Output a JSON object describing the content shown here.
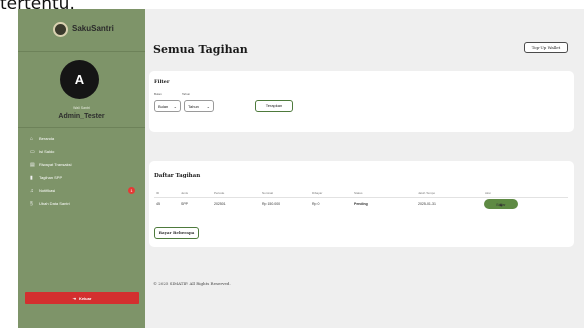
{
  "top_text": "tertentu.",
  "brand": {
    "name": "SakuSantri"
  },
  "user": {
    "avatar_letter": "A",
    "role": "Wali Santri",
    "username": "Admin_Tester"
  },
  "menu": [
    {
      "icon": "home-icon",
      "glyph": "⌂",
      "label": "Beranda"
    },
    {
      "icon": "card-icon",
      "glyph": "▭",
      "label": "Isi Saldo"
    },
    {
      "icon": "receipt-icon",
      "glyph": "▤",
      "label": "Riwayat Transaksi"
    },
    {
      "icon": "invoice-icon",
      "glyph": "▮",
      "label": "Tagihan SPP"
    },
    {
      "icon": "bell-icon",
      "glyph": "♫",
      "label": "Notifikasi",
      "badge": "1"
    },
    {
      "icon": "student-data-icon",
      "glyph": "§",
      "label": "Ubah Data Santri"
    }
  ],
  "logout_label": "Keluar",
  "main": {
    "title": "Semua Tagihan",
    "topup_label": "Top-Up Wallet"
  },
  "filter": {
    "title": "Filter",
    "month_label": "Bulan",
    "month_value": "Bulan",
    "year_label": "Tahun",
    "year_value": "Tahun",
    "apply_label": "Terapkan"
  },
  "bills": {
    "title": "Daftar Tagihan",
    "columns": [
      "ID",
      "Jenis",
      "Periode",
      "Nominal",
      "Dibayar",
      "Status",
      "Jatuh Tempo",
      "Aksi"
    ],
    "rows": [
      {
        "id": "45",
        "jenis": "SPP",
        "periode": "202501",
        "nominal": "Rp 150.000",
        "dibayar": "Rp 0",
        "status": "Pending",
        "jatuh_tempo": "2025-01-31",
        "aksi": "Bayar"
      }
    ],
    "history_label": "Bayar Beberapa"
  },
  "footer": "© 2025 SIMATIP. All Rights Reserved.",
  "colors": {
    "sidebar": "#7e9469",
    "accent": "#5e8a43",
    "danger": "#d32f2f",
    "background": "#efefef"
  }
}
